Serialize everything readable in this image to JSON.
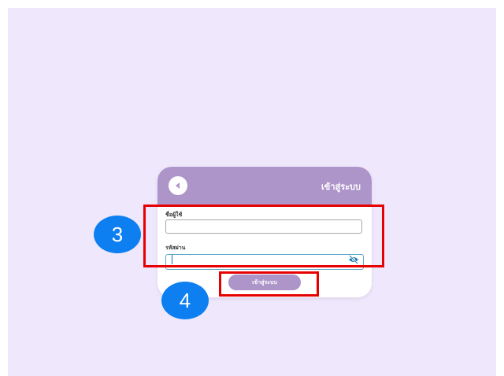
{
  "login": {
    "title": "เข้าสู่ระบบ",
    "username_label": "ชื่อผู้ใช้",
    "username_value": "",
    "password_label": "รหัสผ่าน",
    "password_value": "",
    "submit_label": "เข้าสู่ระบบ"
  },
  "icons": {
    "back": "back-arrow-circle-icon",
    "password_toggle": "eye-slash-icon"
  },
  "annotations": {
    "step_fields": "3",
    "step_button": "4"
  },
  "colors": {
    "page_background": "#efe7fb",
    "header": "#ad94c9",
    "button": "#ad94c9",
    "highlight": "#e60000",
    "badge": "#0d7ff0",
    "eye_icon": "#1e7fb0"
  }
}
